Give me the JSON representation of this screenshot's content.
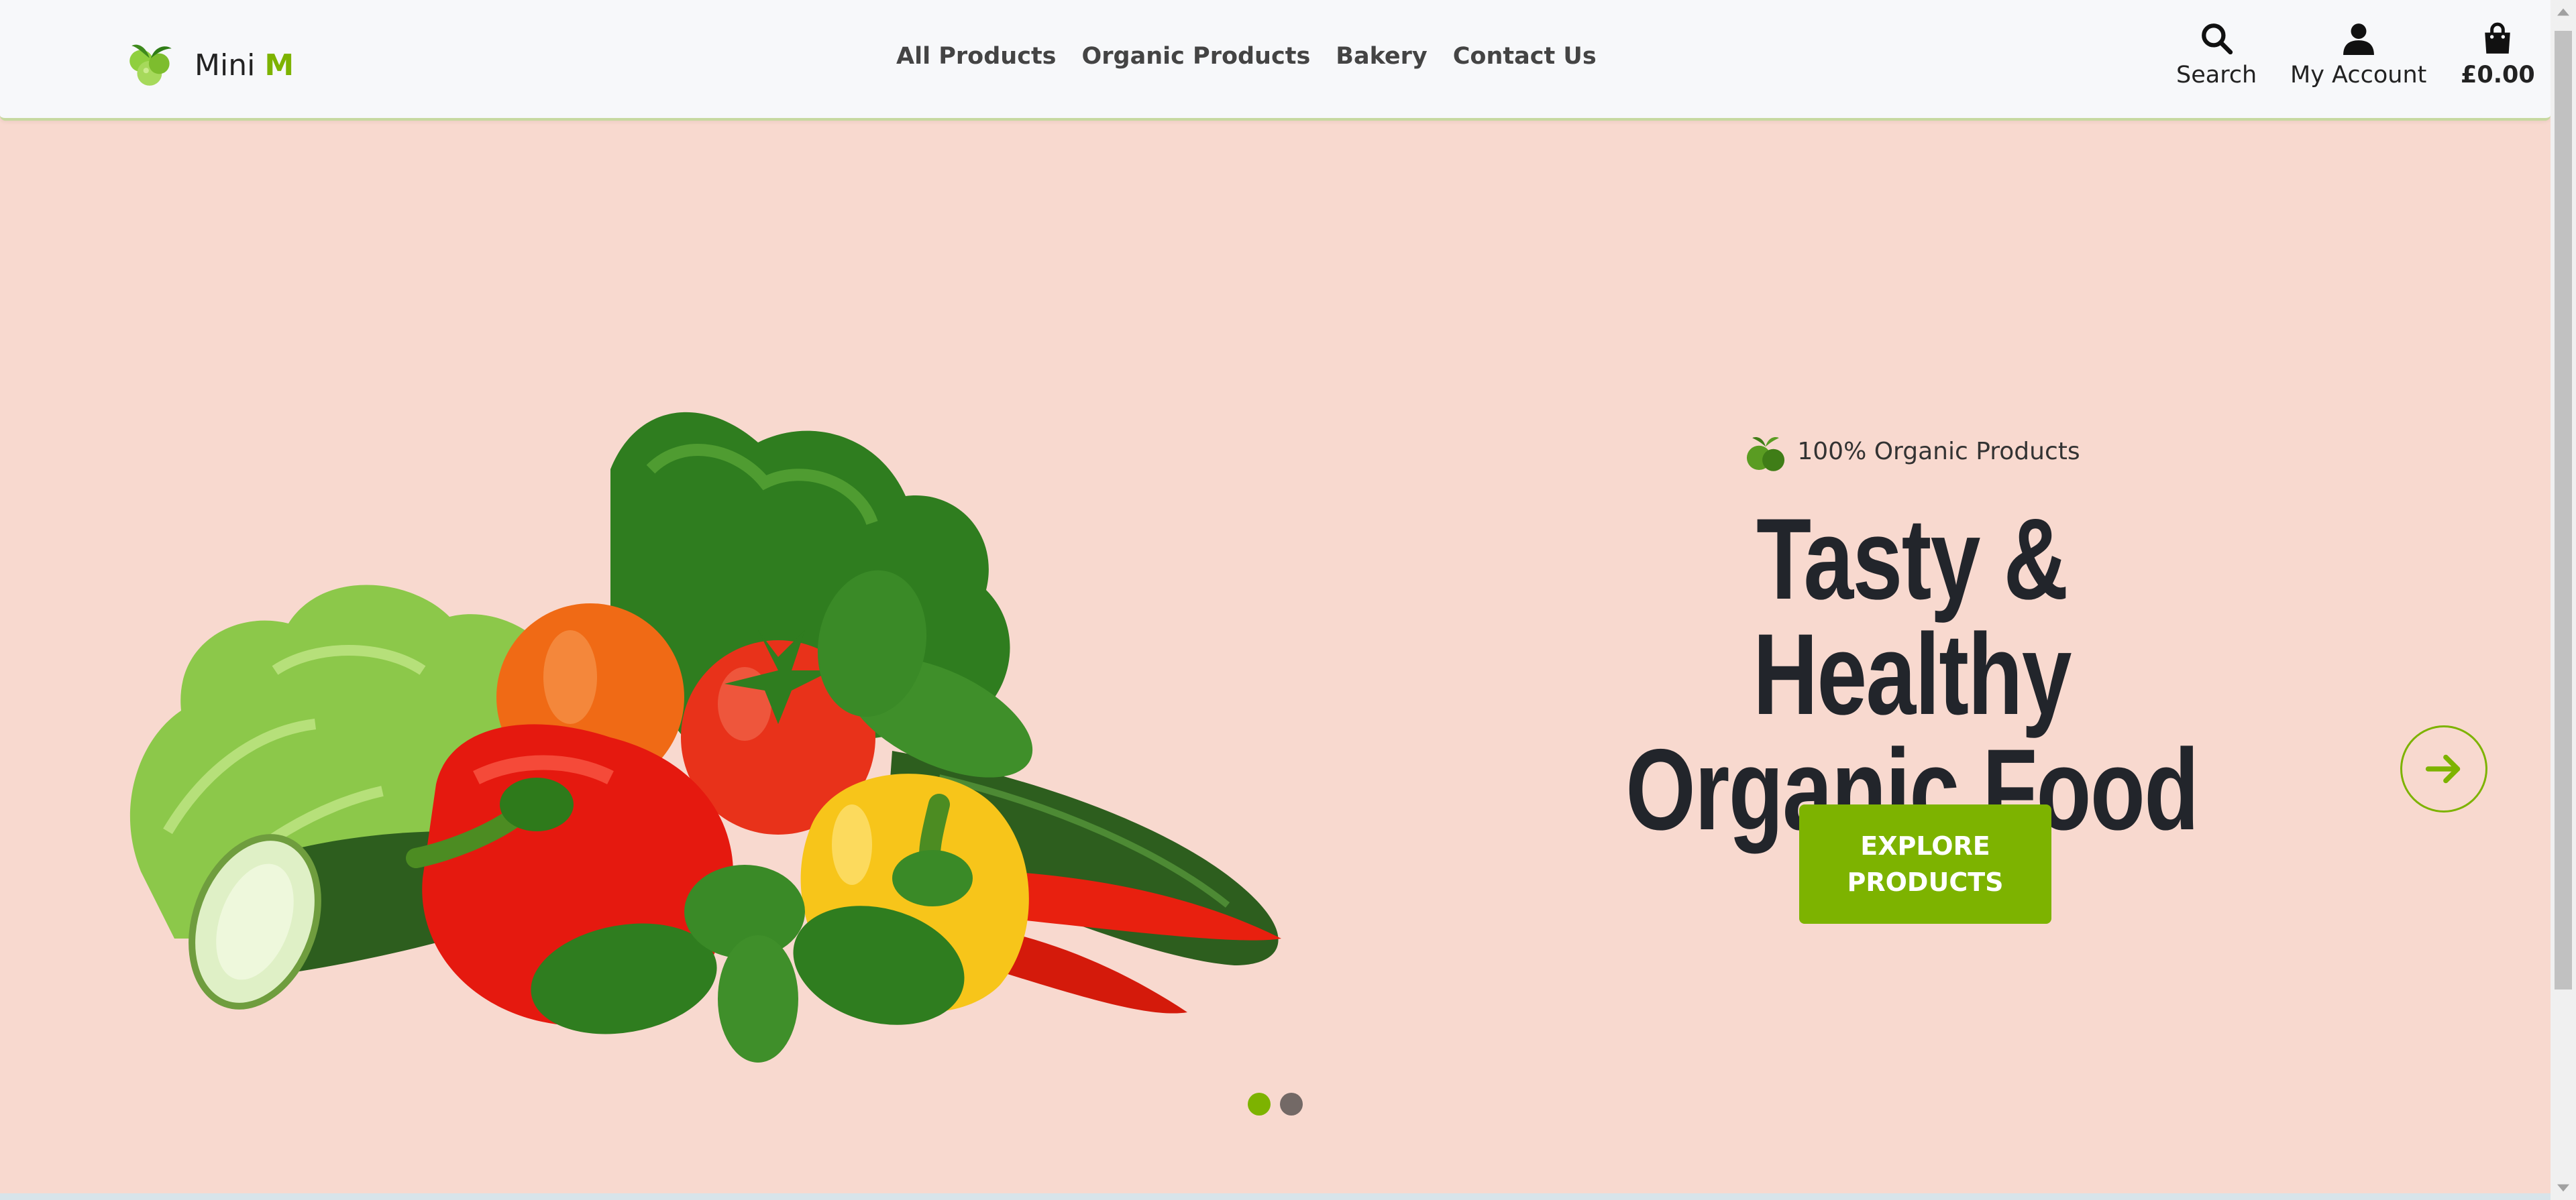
{
  "header": {
    "logo": {
      "text": "Mini",
      "accent": "M",
      "icon": "apple-logo-icon"
    },
    "nav": [
      {
        "label": "All Products"
      },
      {
        "label": "Organic Products"
      },
      {
        "label": "Bakery"
      },
      {
        "label": "Contact Us"
      }
    ],
    "utilities": {
      "search": {
        "label": "Search",
        "icon": "search-icon"
      },
      "account": {
        "label": "My Account",
        "icon": "user-icon"
      },
      "cart": {
        "label": "£0.00",
        "icon": "shopping-bag-icon"
      }
    }
  },
  "hero": {
    "tagline": "100% Organic Products",
    "title_line1": "Tasty & Healthy",
    "title_line2": "Organic Food",
    "cta_label": "EXPLORE PRODUCTS",
    "image": "vegetables-image",
    "next_icon": "arrow-right-icon",
    "slides": {
      "count": 2,
      "active": 1
    }
  },
  "colors": {
    "accent": "#7db300",
    "hero_background": "#f8d9cf",
    "header_background": "#f7f8fa",
    "title": "#22252b"
  }
}
